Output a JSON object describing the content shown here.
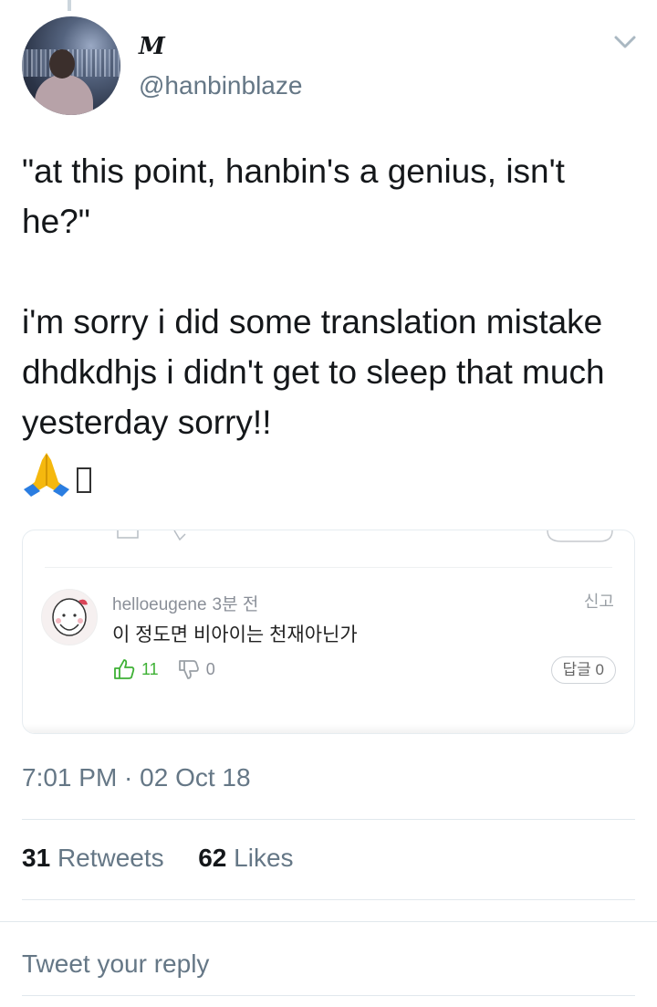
{
  "tweet": {
    "display_name": "M",
    "handle": "@hanbinblaze",
    "text": "\"at this point, hanbin's a genius, isn't he?\"\n\ni'm sorry i did some translation mistake dhdkdhjs i didn't get to sleep that much yesterday sorry!!",
    "emoji": "🙏",
    "timestamp": "7:01 PM · 02 Oct 18",
    "retweets": "31",
    "retweets_label": "Retweets",
    "likes": "62",
    "likes_label": "Likes",
    "reply_placeholder": "Tweet your reply"
  },
  "embedded_comment": {
    "username": "helloeugene",
    "time": "3분 전",
    "report": "신고",
    "text": "이 정도면 비아이는 천재아닌가",
    "likes": "11",
    "dislikes": "0",
    "reply_button": "답글 0"
  },
  "colors": {
    "secondary_text": "#657786",
    "like_green": "#3eb135",
    "border": "#e1e8ed"
  }
}
